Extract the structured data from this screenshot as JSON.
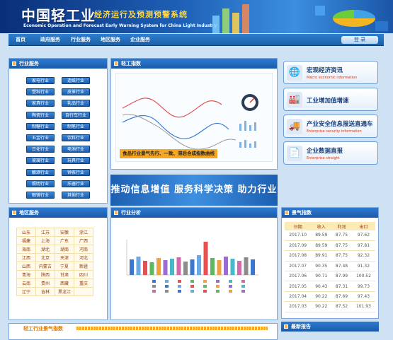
{
  "header": {
    "logo": "中国轻工业",
    "subtitle": "经济运行及预测预警系统",
    "english": "Economic Operation and Forecast Early Warning System for China Light Industry"
  },
  "nav": {
    "items": [
      "首页",
      "政府服务",
      "行业服务",
      "地区服务",
      "企业服务"
    ],
    "login": "登 录"
  },
  "industry_panel": {
    "title": "行业服务",
    "items": [
      "家电行业",
      "造纸行业",
      "塑料行业",
      "皮革行业",
      "家具行业",
      "乳品行业",
      "陶瓷行业",
      "自行车行业",
      "制糖行业",
      "制笔行业",
      "五金行业",
      "饮料行业",
      "日化行业",
      "电池行业",
      "玻璃行业",
      "玩具行业",
      "酿酒行业",
      "钟表行业",
      "照明行业",
      "乐器行业",
      "眼镜行业",
      "其他行业"
    ]
  },
  "index_panel": {
    "title": "轻工指数",
    "caption": "食品行业景气先行、一致、滞后合成指数曲线"
  },
  "banner": {
    "text": "推动信息增值  服务科学决策  助力行业发展"
  },
  "right_buttons": [
    {
      "title": "宏观经济资讯",
      "sub": "Macro economic information",
      "icon": "globe-icon"
    },
    {
      "title": "工业增加值增速",
      "sub": "",
      "icon": "factory-icon"
    },
    {
      "title": "产业安全信息报送直通车",
      "sub": "Enterprise security information",
      "icon": "truck-icon"
    },
    {
      "title": "企业数据直报",
      "sub": "Enterprise straight",
      "icon": "document-icon"
    }
  ],
  "region_panel": {
    "title": "地区服务",
    "items": [
      "山东",
      "江苏",
      "安徽",
      "浙江",
      "福建",
      "上海",
      "广东",
      "广西",
      "海南",
      "湖北",
      "湖南",
      "河南",
      "江西",
      "北京",
      "天津",
      "河北",
      "山西",
      "内蒙古",
      "宁夏",
      "新疆",
      "青海",
      "陕西",
      "甘肃",
      "四川",
      "云南",
      "贵州",
      "西藏",
      "重庆",
      "辽宁",
      "吉林",
      "黑龙江",
      ""
    ]
  },
  "analysis_panel": {
    "title": "行业分析"
  },
  "jingqi_panel": {
    "title": "景气指数",
    "columns": [
      "日期",
      "收入",
      "利润",
      "出口"
    ],
    "rows": [
      [
        "2017.10",
        "89.59",
        "87.75",
        "97.62"
      ],
      [
        "2017.09",
        "89.59",
        "87.75",
        "97.81"
      ],
      [
        "2017.08",
        "89.91",
        "87.75",
        "92.32"
      ],
      [
        "2017.07",
        "90.35",
        "87.48",
        "91.32"
      ],
      [
        "2017.06",
        "90.71",
        "87.99",
        "100.52"
      ],
      [
        "2017.05",
        "90.43",
        "87.31",
        "99.73"
      ],
      [
        "2017.04",
        "90.22",
        "87.69",
        "97.43"
      ],
      [
        "2017.03",
        "90.22",
        "87.52",
        "101.93"
      ]
    ]
  },
  "bottom": {
    "left_title": "轻工行业景气指数",
    "right_title": "最新报告"
  },
  "colors": {
    "nav": "#1b5fa8",
    "accent": "#ffb347",
    "panel_border": "#7ba8d8"
  }
}
